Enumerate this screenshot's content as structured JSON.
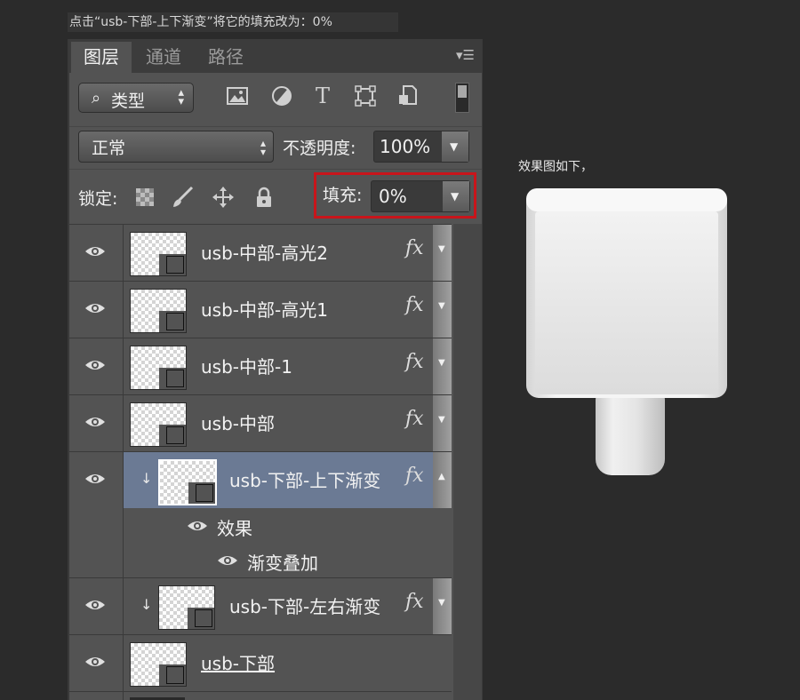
{
  "instruction": "点击“usb-下部-上下渐变”将它的填充改为：0%",
  "panel": {
    "tabs": [
      "图层",
      "通道",
      "路径"
    ],
    "menu_icon": "panel-menu-icon",
    "filter": {
      "label": "类型",
      "icon": "search-icon"
    },
    "filter_icons": [
      "image-filter-icon",
      "adjustment-filter-icon",
      "type-filter-icon",
      "shape-filter-icon",
      "smart-object-filter-icon"
    ],
    "filter_type_glyph": "T",
    "blend_mode": "正常",
    "opacity_label": "不透明度:",
    "opacity_value": "100%",
    "lock_label": "锁定:",
    "lock_icons": [
      "lock-transparent-icon",
      "lock-image-icon",
      "lock-position-icon",
      "lock-all-icon"
    ],
    "fill_label": "填充:",
    "fill_value": "0%",
    "highlight_color": "#c8151b"
  },
  "layers": [
    {
      "name": "usb-中部-高光2",
      "fx": "fx"
    },
    {
      "name": "usb-中部-高光1",
      "fx": "fx"
    },
    {
      "name": "usb-中部-1",
      "fx": "fx"
    },
    {
      "name": "usb-中部",
      "fx": "fx"
    },
    {
      "name": "usb-下部-上下渐变",
      "fx": "fx",
      "selected": true,
      "clipped": true
    },
    {
      "name": "usb-下部-左右渐变",
      "fx": "fx",
      "clipped": true
    },
    {
      "name": "usb-下部"
    }
  ],
  "effects": {
    "title": "效果",
    "items": [
      "渐变叠加"
    ]
  },
  "preview": {
    "label": "效果图如下，"
  },
  "colors": {
    "selected_row": "#6b7a94",
    "panel_bg": "#535353",
    "canvas_bg": "#2b2b2b"
  }
}
